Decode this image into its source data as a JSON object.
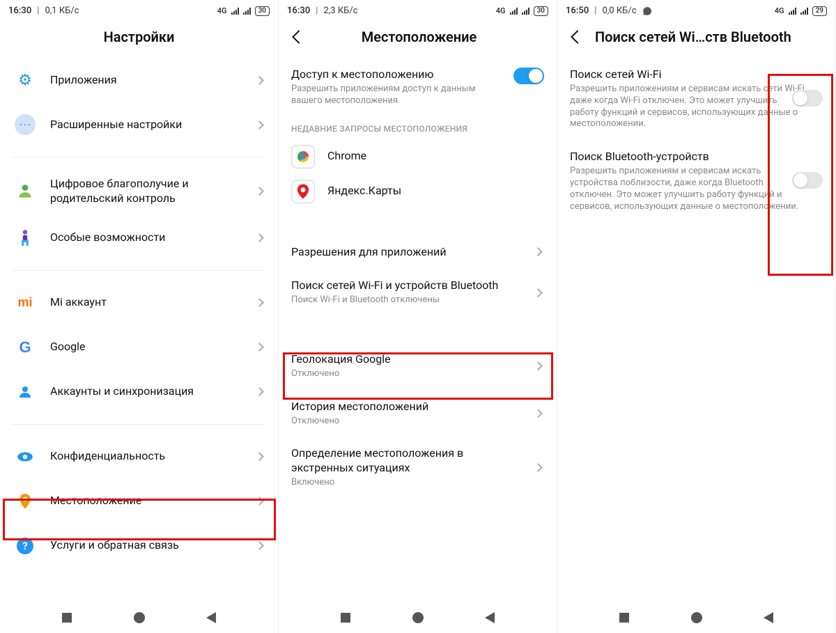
{
  "p1": {
    "status": {
      "time": "16:30",
      "speed": "0,1 КБ/с",
      "net": "4G",
      "battery": "30"
    },
    "title": "Настройки",
    "items": {
      "apps": "Приложения",
      "advanced": "Расширенные настройки",
      "wellbeing": "Цифровое благополучие и родительский контроль",
      "accessibility": "Особые возможности",
      "mi_account": "Mi аккаунт",
      "google": "Google",
      "accounts_sync": "Аккаунты и синхронизация",
      "privacy": "Конфиденциальность",
      "location": "Местоположение",
      "feedback": "Услуги и обратная связь"
    }
  },
  "p2": {
    "status": {
      "time": "16:30",
      "speed": "2,3 КБ/с",
      "net": "4G",
      "battery": "30"
    },
    "title": "Местоположение",
    "access": {
      "title": "Доступ к местоположению",
      "sub": "Разрешить приложениям доступ к данным вашего местоположения"
    },
    "recent_label": "НЕДАВНИЕ ЗАПРОСЫ МЕСТОПОЛОЖЕНИЯ",
    "recent": {
      "chrome": "Chrome",
      "ymaps": "Яндекс.Карты"
    },
    "perm": "Разрешения для приложений",
    "scan": {
      "title": "Поиск сетей Wi-Fi и устройств Bluetooth",
      "sub": "Поиск Wi-Fi и Bluetooth отключены"
    },
    "google_loc": {
      "title": "Геолокация Google",
      "sub": "Отключено"
    },
    "history": {
      "title": "История местоположений",
      "sub": "Отключено"
    },
    "emergency": {
      "title": "Определение местоположения в экстренных ситуациях",
      "sub": "Включено"
    }
  },
  "p3": {
    "status": {
      "time": "16:50",
      "speed": "0,0 КБ/с",
      "net": "4G",
      "battery": "29"
    },
    "title": "Поиск сетей Wi…ств Bluetooth",
    "wifi": {
      "title": "Поиск сетей Wi-Fi",
      "sub": "Разрешить приложениям и сервисам искать сети Wi-Fi, даже когда Wi-Fi отключен. Это может улучшить работу функций и сервисов, использующих данные о местоположении."
    },
    "bt": {
      "title": "Поиск Bluetooth-устройств",
      "sub": "Разрешить приложениям и сервисам искать устройства поблизости, даже когда Bluetooth отключен. Это может улучшить работу функций и сервисов, использующих данные о местоположении."
    }
  }
}
